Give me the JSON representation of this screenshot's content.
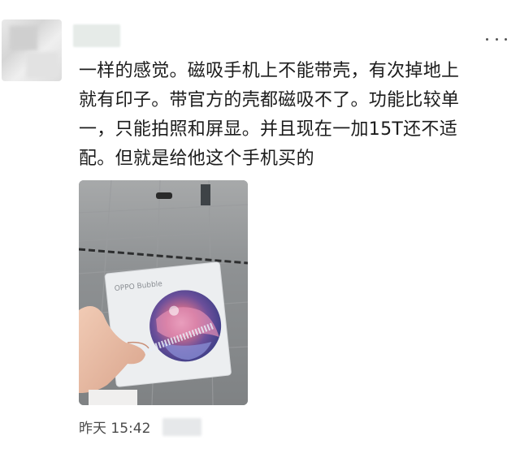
{
  "post": {
    "text": "一样的感觉。磁吸手机上不能带壳，有次掉地上\n就有印子。带官方的壳都磁吸不了。功能比较单\n一，只能拍照和屏显。并且现在一加15T还不适\n配。但就是给他这个手机买的",
    "photo": {
      "product_label": "OPPO Bubble"
    },
    "timestamp": "昨天 15:42"
  },
  "icons": {
    "more": "more-dots-icon"
  }
}
